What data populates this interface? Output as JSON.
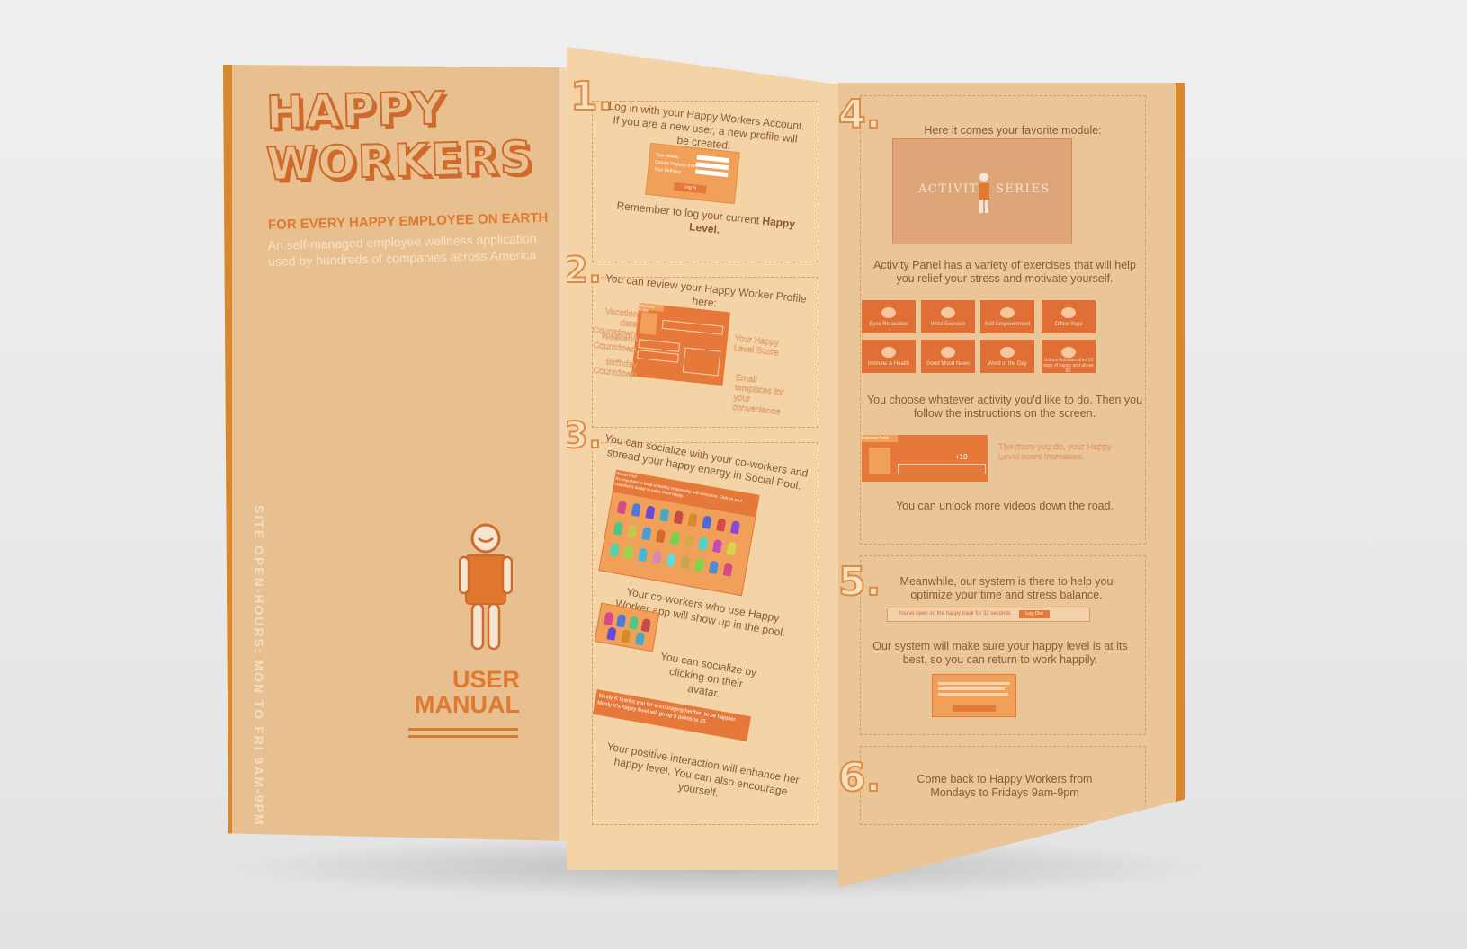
{
  "cover": {
    "title_line1": "HAPPY",
    "title_line2": "WORKERS",
    "tagline": "FOR EVERY HAPPY EMPLOYEE ON EARTH",
    "description": "An self-managed employee wellness application used by hundreds of companies across America",
    "site_hours": "SITE OPEN-HOURS: MON TO FRI 9AM-9PM",
    "manual_line1": "USER",
    "manual_line2": "MANUAL"
  },
  "step1": {
    "number": "1.",
    "text": "Log in with your Happy Workers Account. If you are a new user, a new profile will be created.",
    "form_labels": [
      "Your Name:",
      "Current Happy Level:",
      "Your Birthday:"
    ],
    "login_button": "Log In",
    "note_prefix": "Remember to log your current ",
    "note_bold": "Happy Level."
  },
  "step2": {
    "number": "2.",
    "text": "You can review your Happy Worker Profile here:",
    "profile_header": "Employee Profile",
    "callouts_left": [
      "Vacation date Countdown",
      "Weekend Countdown",
      "Birthday Countdown"
    ],
    "callouts_right": [
      "Your Happy Level Score",
      "Email templates for your convenience"
    ]
  },
  "step3": {
    "number": "3.",
    "text": "You can socialize with your co-workers and spread your happy energy in Social Pool.",
    "pool_header": "Social Pool",
    "pool_notice": "It's important to keep a healthy relationship with everyone. Click on your coworker's avatar to make them happy.",
    "coworkers_text": "Your co-workers who use Happy Worker app will show up in the pool.",
    "avatar_text": "You can socialize by clicking on their avatar.",
    "message": "Mindy K thanks you for encouraging her/him to be happier. Mindy K's happy level will go up 5 points to 25.",
    "closing_text": "Your positive interaction will enhance her happy level. You can also encourage yourself."
  },
  "step4": {
    "number": "4.",
    "intro": "Here it comes your favorite module:",
    "activity_title_left": "ACTIVITY",
    "activity_title_right": "SERIES",
    "panel_text": "Activity Panel has a variety of exercises that will help you relief your stress and motivate yourself.",
    "tiles": [
      "Eyes Relaxation",
      "Wrist Exercise",
      "Self Empowerment",
      "Office Yoga",
      "Immune & Health",
      "Good Mood News",
      "Word of the Day",
      "Unlock Activities after 10 days of happy and above 80."
    ],
    "choose_text": "You choose whatever activity you'd like to do. Then you follow the instructions on the screen.",
    "profile_header": "Employee Profile",
    "score_badge": "+10",
    "score_note": "The more you do, your Happy Level score increases.",
    "unlock_text": "You can unlock more videos down the road."
  },
  "step5": {
    "number": "5.",
    "text": "Meanwhile, our system is there to help you optimize your time and stress balance.",
    "tracker_text": "You've been on the happy track for 32 seconds",
    "logout_button": "Log Out",
    "result_text": "Our system will make sure your happy level is at its best, so you can return to work happily."
  },
  "step6": {
    "number": "6.",
    "text": "Come back to Happy Workers from Mondays to Fridays 9am-9pm"
  },
  "colors": {
    "accent": "#e07a30",
    "paper": "#e9c597",
    "tile": "#df6f34",
    "locked_tile": "#8e4a20"
  }
}
